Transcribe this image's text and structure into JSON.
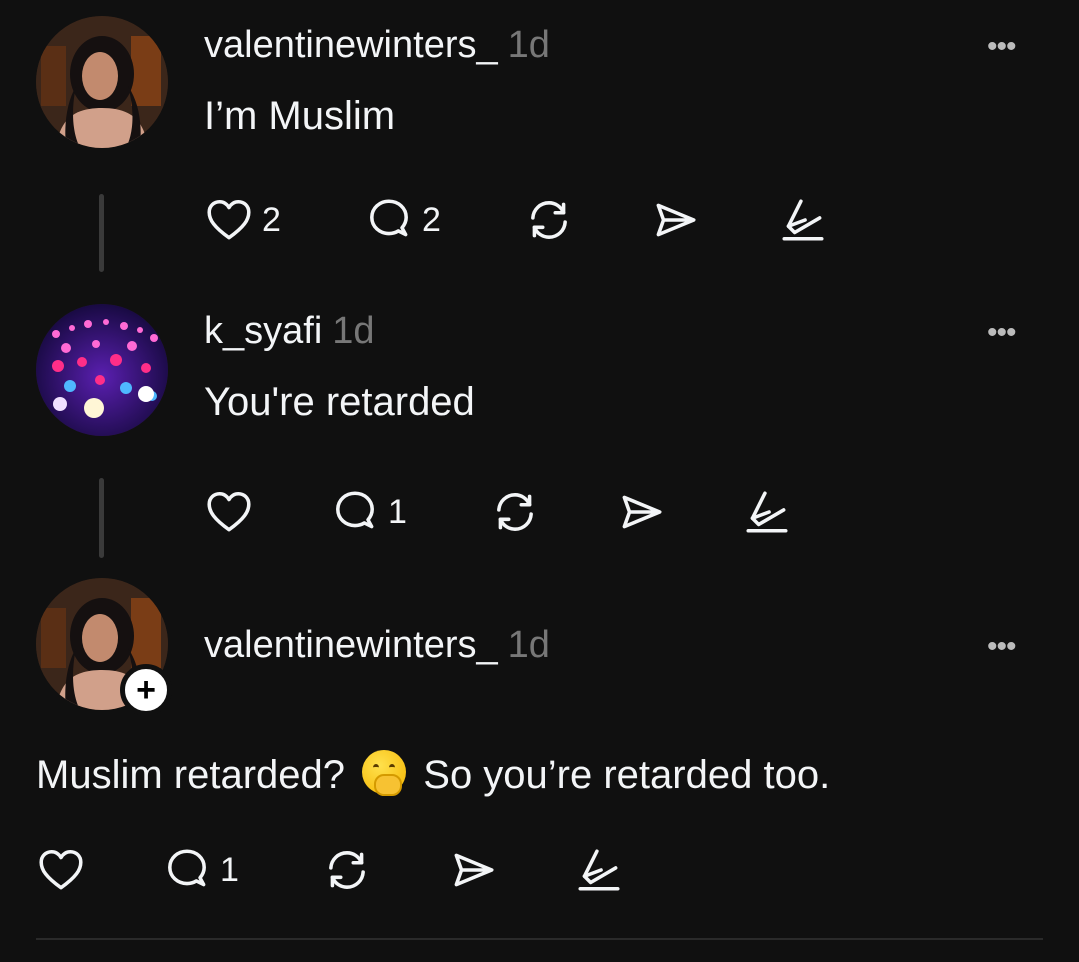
{
  "posts": [
    {
      "username": "valentinewinters_",
      "time": "1d",
      "text": "I’m Muslim",
      "likes": "2",
      "replies": "2"
    },
    {
      "username": "k_syafi",
      "time": "1d",
      "text": "You're retarded",
      "likes": "",
      "replies": "1"
    },
    {
      "username": "valentinewinters_",
      "time": "1d",
      "text_before_emoji": "Muslim retarded?",
      "emoji": "hand-over-mouth-emoji",
      "text_after_emoji": "So you’re retarded too.",
      "likes": "",
      "replies": "1"
    }
  ],
  "more_label": "•••",
  "follow_label": "+"
}
